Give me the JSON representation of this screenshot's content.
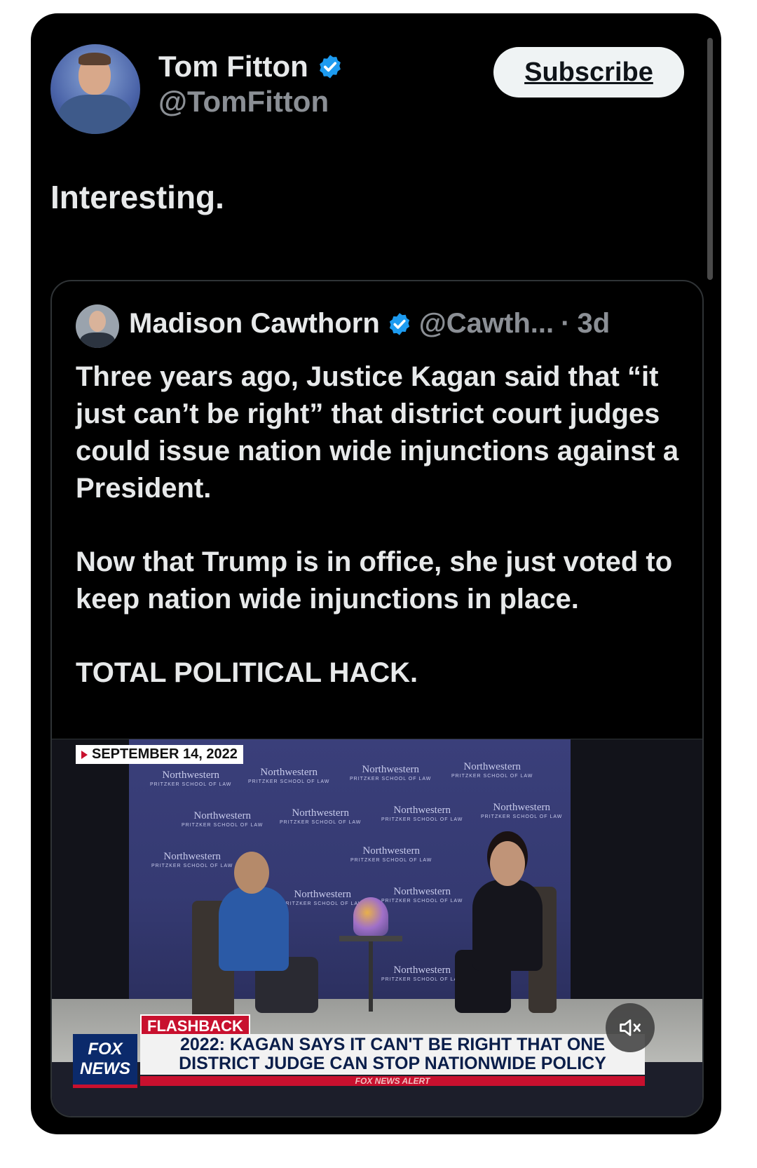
{
  "author": {
    "name": "Tom Fitton",
    "handle": "@TomFitton"
  },
  "subscribe_label": "Subscribe",
  "tweet_text": "Interesting.",
  "quoted": {
    "name": "Madison Cawthorn",
    "handle": "@Cawth...",
    "dot": "·",
    "time": "3d",
    "paragraphs": [
      "Three years ago, Justice Kagan said that “it just can’t be right” that district court judges could issue nation wide injunctions against a President.",
      "Now that Trump is in office, she just voted to keep nation wide injunctions in place.",
      "TOTAL POLITICAL HACK."
    ]
  },
  "video": {
    "date_tag": "SEPTEMBER 14, 2022",
    "backdrop_logo": "Northwestern",
    "backdrop_logo_sub": "PRITZKER SCHOOL OF LAW",
    "flashback": "FLASHBACK",
    "network_logo_line1": "FOX",
    "network_logo_line2": "NEWS",
    "headline_line1": "2022: KAGAN SAYS IT CAN'T BE RIGHT THAT ONE",
    "headline_line2": "DISTRICT JUDGE CAN STOP NATIONWIDE POLICY",
    "alert_bar": "FOX NEWS ALERT",
    "mute_icon": "speaker-muted-icon"
  },
  "colors": {
    "background": "#000000",
    "verified_blue": "#1d9bf0",
    "text_primary": "#e7e9ea",
    "text_secondary": "#8b8f95",
    "fox_red": "#c8102e",
    "fox_blue": "#0b2a6b"
  }
}
